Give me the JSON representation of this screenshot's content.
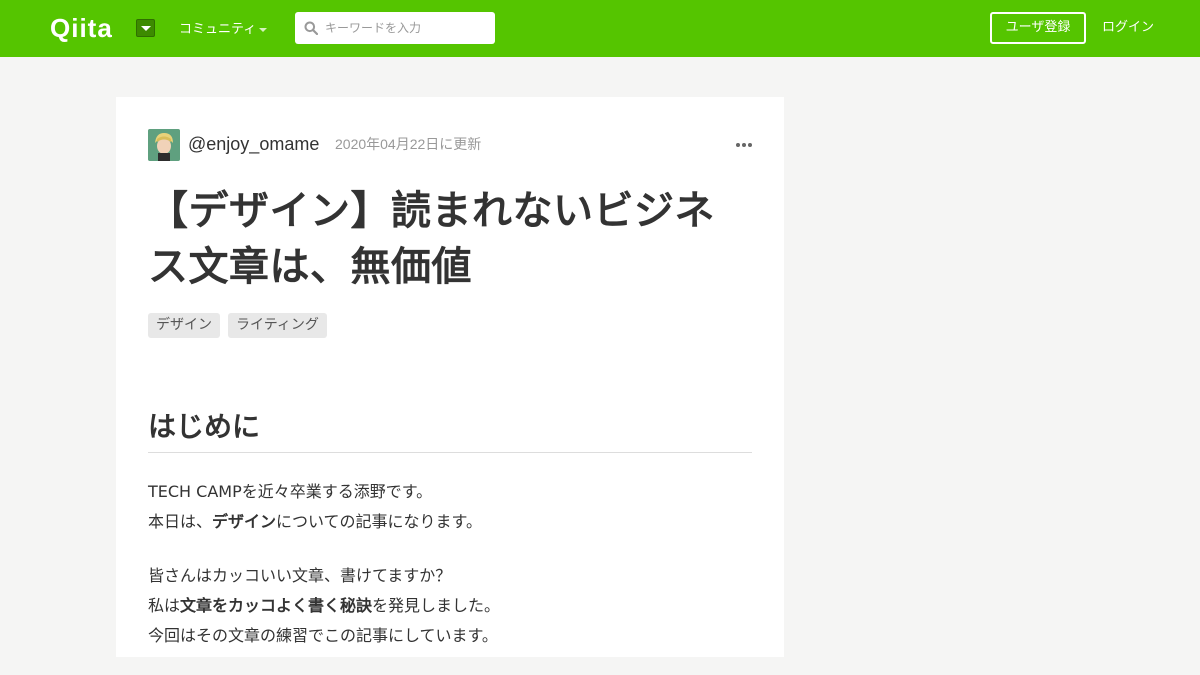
{
  "header": {
    "logo": "Qiita",
    "community_label": "コミュニティ",
    "search_placeholder": "キーワードを入力",
    "signup_label": "ユーザ登録",
    "login_label": "ログイン",
    "brand_color": "#55c500"
  },
  "article": {
    "author": "@enjoy_omame",
    "updated": "2020年04月22日に更新",
    "title_line1": "【デザイン】読まれないビジネ",
    "title_line2": "ス文章は、無価値",
    "tags": [
      "デザイン",
      "ライティング"
    ],
    "section_heading": "はじめに",
    "paragraphs": [
      [
        {
          "text": "TECH CAMPを近々卒業する添野です。"
        },
        {
          "br": true
        },
        {
          "text": "本日は、"
        },
        {
          "text": "デザイン",
          "bold": true
        },
        {
          "text": "についての記事になります。"
        }
      ],
      [
        {
          "text": "皆さんはカッコいい文章、書けてますか？"
        },
        {
          "br": true
        },
        {
          "text": "私は"
        },
        {
          "text": "文章をカッコよく書く秘訣",
          "bold": true
        },
        {
          "text": "を発見しました。"
        },
        {
          "br": true
        },
        {
          "text": "今回はその文章の練習でこの記事にしています。"
        }
      ]
    ]
  }
}
